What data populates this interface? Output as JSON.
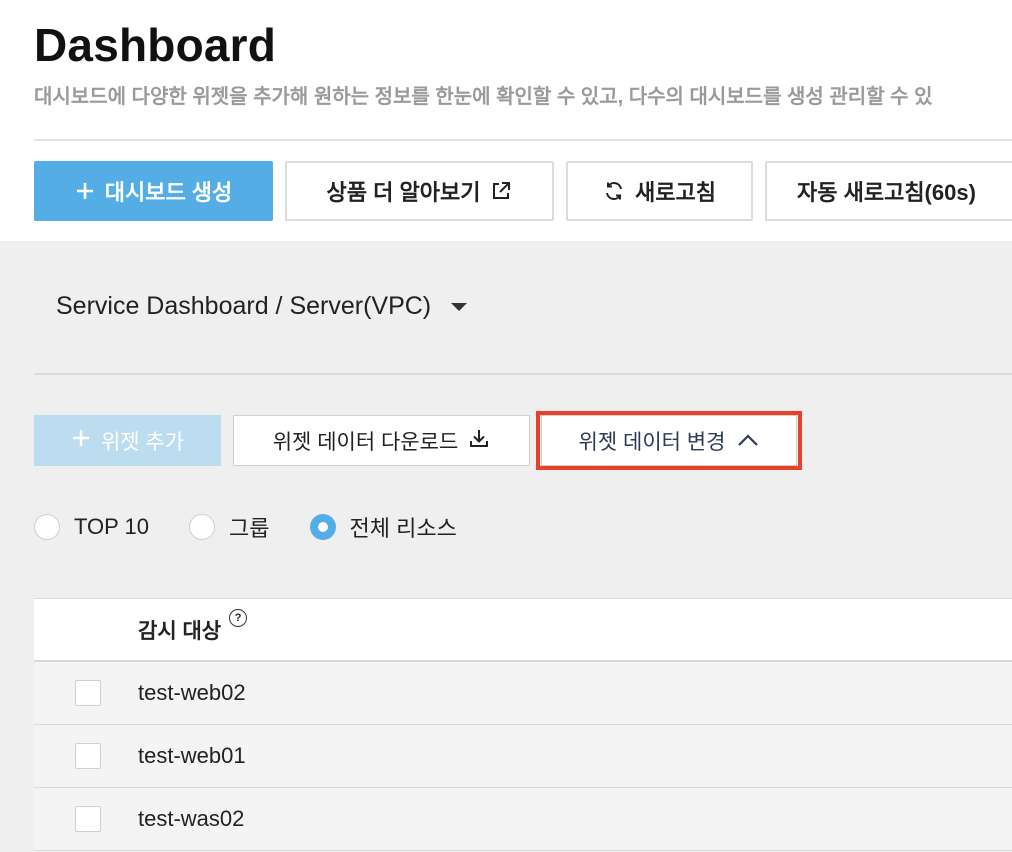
{
  "header": {
    "title": "Dashboard",
    "subtitle": "대시보드에 다양한 위젯을 추가해 원하는 정보를 한눈에 확인할 수 있고, 다수의 대시보드를 생성 관리할 수 있"
  },
  "toolbar": {
    "create_label": "대시보드 생성",
    "learn_more_label": "상품 더 알아보기",
    "refresh_label": "새로고침",
    "auto_refresh_label": "자동 새로고침(60s)"
  },
  "dashboard": {
    "selected": "Service Dashboard / Server(VPC)"
  },
  "widget_toolbar": {
    "add_label": "위젯 추가",
    "download_label": "위젯 데이터 다운로드",
    "change_label": "위젯 데이터 변경"
  },
  "radio_options": {
    "top10": "TOP 10",
    "group": "그룹",
    "all": "전체 리소스",
    "selected": "전체 리소스"
  },
  "table": {
    "header": "감시 대상",
    "rows": [
      "test-web02",
      "test-web01",
      "test-was02"
    ]
  },
  "colors": {
    "primary": "#55ade6",
    "highlight": "#e8412b"
  },
  "icons": [
    "plus-icon",
    "external-link-icon",
    "refresh-icon",
    "download-icon",
    "chevron-up-icon",
    "help-icon",
    "caret-down-icon"
  ]
}
